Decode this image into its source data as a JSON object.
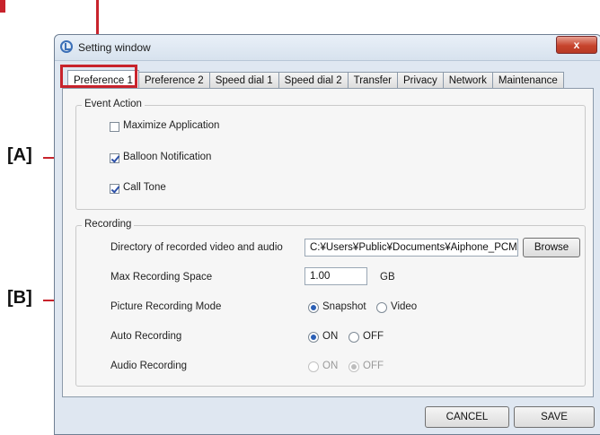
{
  "annotations": {
    "a": "[A]",
    "b": "[B]"
  },
  "window": {
    "title": "Setting window",
    "close_label": "x"
  },
  "tabs": [
    {
      "label": "Preference 1",
      "active": true
    },
    {
      "label": "Preference 2",
      "active": false
    },
    {
      "label": "Speed dial 1",
      "active": false
    },
    {
      "label": "Speed dial 2",
      "active": false
    },
    {
      "label": "Transfer",
      "active": false
    },
    {
      "label": "Privacy",
      "active": false
    },
    {
      "label": "Network",
      "active": false
    },
    {
      "label": "Maintenance",
      "active": false
    }
  ],
  "event_action": {
    "title": "Event Action",
    "items": [
      {
        "label": "Maximize Application",
        "checked": false
      },
      {
        "label": "Balloon Notification",
        "checked": true
      },
      {
        "label": "Call Tone",
        "checked": true
      }
    ]
  },
  "recording": {
    "title": "Recording",
    "directory_label": "Directory of recorded video and audio",
    "directory_value": "C:¥Users¥Public¥Documents¥Aiphone_PCM",
    "browse_label": "Browse",
    "max_space_label": "Max Recording Space",
    "max_space_value": "1.00",
    "max_space_unit": "GB",
    "picture_mode_label": "Picture Recording Mode",
    "picture_mode_options": [
      "Snapshot",
      "Video"
    ],
    "picture_mode_selected": "Snapshot",
    "auto_label": "Auto Recording",
    "auto_options": [
      "ON",
      "OFF"
    ],
    "auto_selected": "ON",
    "audio_label": "Audio Recording",
    "audio_options": [
      "ON",
      "OFF"
    ],
    "audio_selected": "OFF"
  },
  "footer": {
    "cancel_label": "CANCEL",
    "save_label": "SAVE"
  },
  "colors": {
    "annotation_red": "#c8232c",
    "accent_blue": "#2b5fb5"
  }
}
